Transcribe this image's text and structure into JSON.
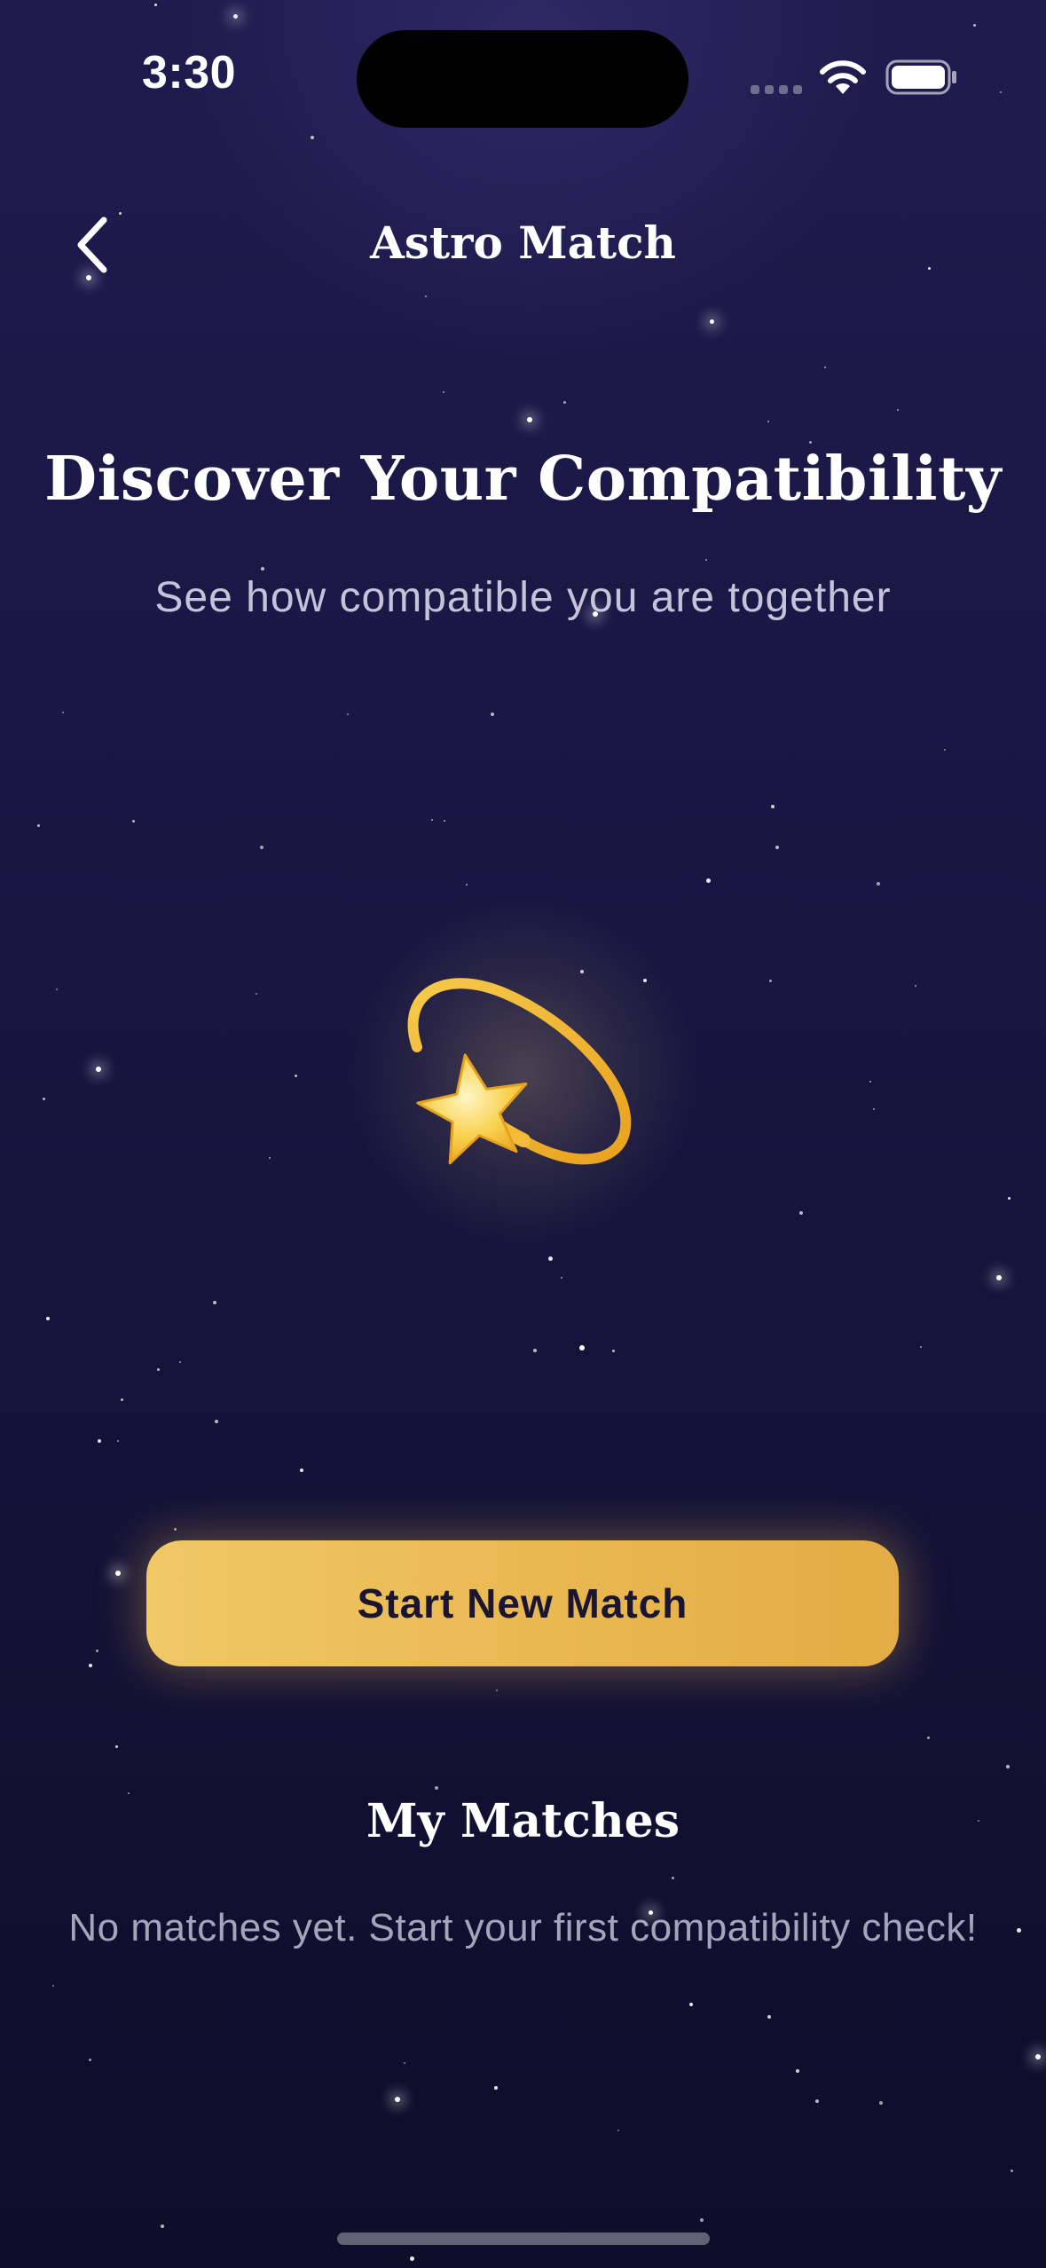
{
  "status_bar": {
    "time": "3:30",
    "icons": [
      "cellular-dots-icon",
      "wifi-icon",
      "battery-icon"
    ]
  },
  "nav": {
    "back_icon": "chevron-left-icon",
    "title": "Astro Match"
  },
  "hero": {
    "headline": "Discover Your Compatibility",
    "subheadline": "See how compatible you are together",
    "icon": "dizzy-star-icon"
  },
  "cta": {
    "label": "Start New Match"
  },
  "matches": {
    "title": "My Matches",
    "empty_message": "No matches yet. Start your first compatibility check!"
  },
  "colors": {
    "background_top": "#1f1b4e",
    "background_bottom": "#0f0d2a",
    "accent_gold": "#eab953",
    "button_text": "#1a1530"
  }
}
